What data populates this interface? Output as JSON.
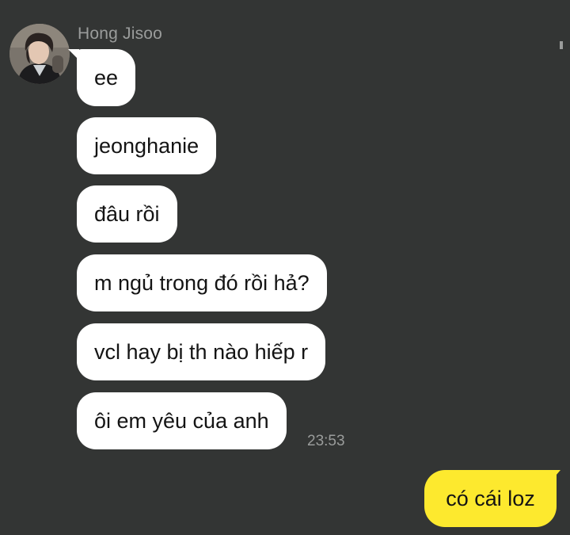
{
  "chat": {
    "contact": {
      "name": "Hong Jisoo",
      "avatar_icon": "profile-photo"
    },
    "incoming_messages": [
      "ee",
      "jeonghanie",
      "đâu rồi",
      "m ngủ trong đó rồi hả?",
      "vcl hay bị th nào hiếp r",
      "ôi em yêu của anh"
    ],
    "incoming_time": "23:53",
    "outgoing_messages": [
      "có cái loz"
    ]
  },
  "colors": {
    "background": "#333534",
    "incoming_bubble": "#ffffff",
    "outgoing_bubble": "#fde92e",
    "meta_text": "#9a9c9b"
  }
}
